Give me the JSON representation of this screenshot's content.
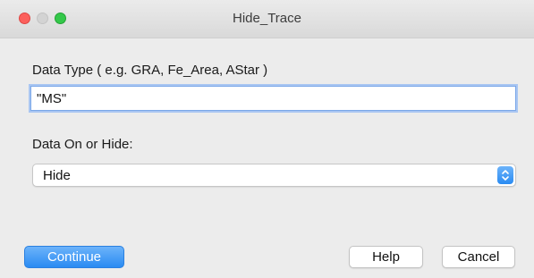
{
  "window": {
    "title": "Hide_Trace"
  },
  "form": {
    "data_type_label": "Data Type ( e.g. GRA, Fe_Area, AStar )",
    "data_type_value": "\"MS\"",
    "data_on_label": "Data On or Hide:",
    "data_on_selected": "Hide"
  },
  "buttons": {
    "continue": "Continue",
    "help": "Help",
    "cancel": "Cancel"
  },
  "icons": {
    "close": "close-icon",
    "minimize": "minimize-icon",
    "zoom": "zoom-icon",
    "select_arrows": "chevron-up-down-icon"
  },
  "colors": {
    "accent": "#2a8bf2",
    "close": "#fc605c",
    "minimize": "#d3d3d3",
    "zoom": "#34c84a"
  }
}
